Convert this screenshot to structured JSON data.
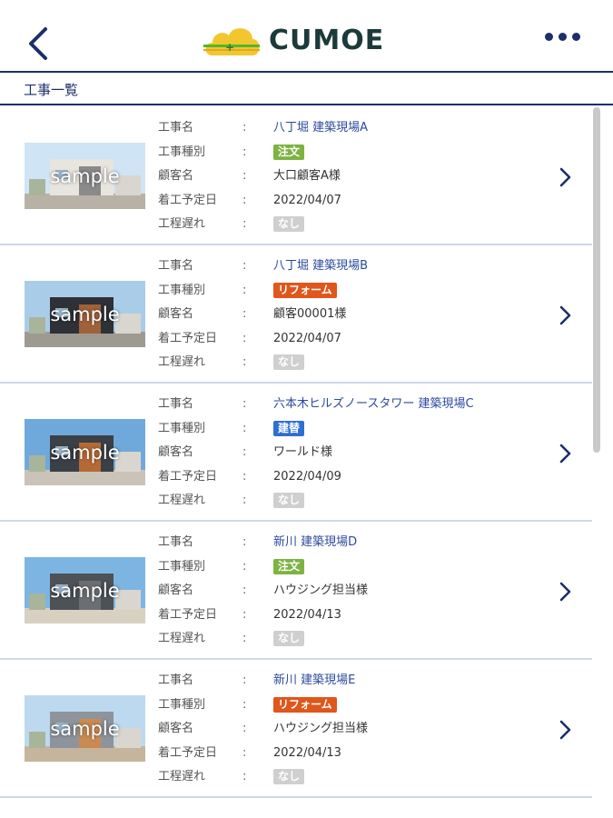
{
  "header": {
    "logo_text": "CUMOE",
    "colors": {
      "navy": "#1c2f6b",
      "logo_yellow": "#f2c62f",
      "logo_green": "#53b82d"
    }
  },
  "section_title": "工事一覧",
  "labels": {
    "name": "工事名",
    "type": "工事種別",
    "customer": "顧客名",
    "start": "着工予定日",
    "delay": "工程遅れ",
    "colon": ":"
  },
  "badge_colors": {
    "注文": "#7cb342",
    "リフォーム": "#e0561b",
    "建替": "#2d6fd1",
    "なし": "#cfcfcf"
  },
  "items": [
    {
      "thumb_label": "sample",
      "name": "八丁堀 建築現場A",
      "type": "注文",
      "customer": "大口顧客A様",
      "start": "2022/04/07",
      "delay": "なし"
    },
    {
      "thumb_label": "sample",
      "name": "八丁堀 建築現場B",
      "type": "リフォーム",
      "customer": "顧客00001様",
      "start": "2022/04/07",
      "delay": "なし"
    },
    {
      "thumb_label": "sample",
      "name": "六本木ヒルズノースタワー 建築現場C",
      "type": "建替",
      "customer": "ワールド様",
      "start": "2022/04/09",
      "delay": "なし"
    },
    {
      "thumb_label": "sample",
      "name": "新川 建築現場D",
      "type": "注文",
      "customer": "ハウジング担当様",
      "start": "2022/04/13",
      "delay": "なし"
    },
    {
      "thumb_label": "sample",
      "name": "新川 建築現場E",
      "type": "リフォーム",
      "customer": "ハウジング担当様",
      "start": "2022/04/13",
      "delay": "なし"
    }
  ]
}
